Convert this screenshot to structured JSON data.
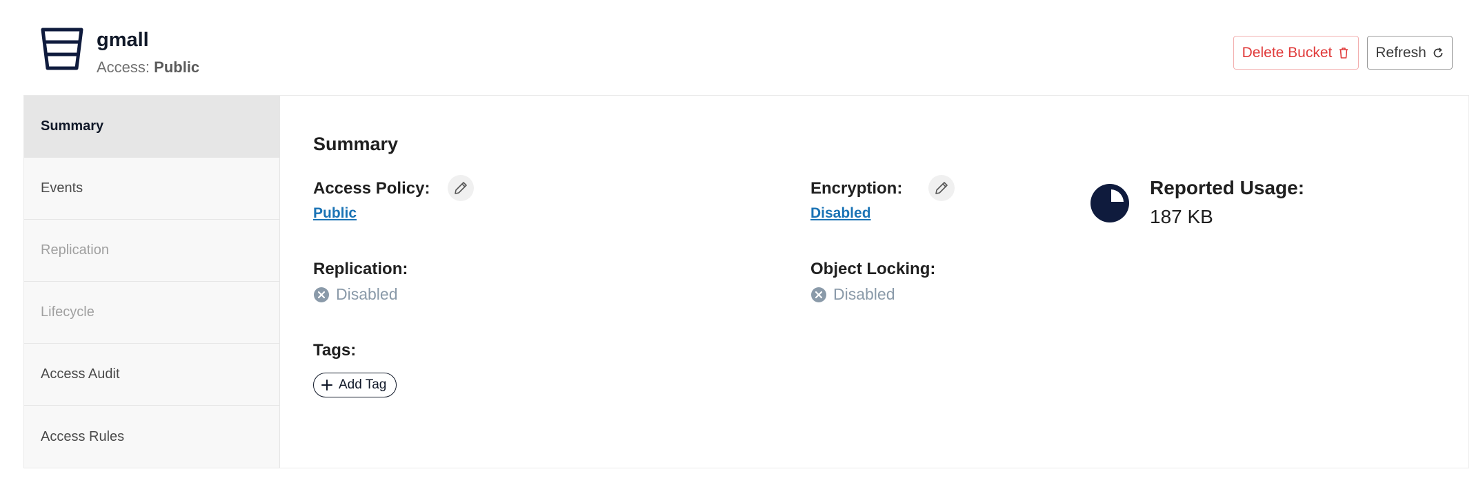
{
  "header": {
    "bucket_name": "gmall",
    "access_label": "Access:",
    "access_value": "Public",
    "delete_label": "Delete Bucket",
    "refresh_label": "Refresh"
  },
  "sidebar": {
    "items": [
      {
        "label": "Summary",
        "state": "active"
      },
      {
        "label": "Events",
        "state": "enabled"
      },
      {
        "label": "Replication",
        "state": "disabled"
      },
      {
        "label": "Lifecycle",
        "state": "disabled"
      },
      {
        "label": "Access Audit",
        "state": "enabled"
      },
      {
        "label": "Access Rules",
        "state": "enabled"
      }
    ]
  },
  "summary": {
    "title": "Summary",
    "access_policy": {
      "label": "Access Policy:",
      "value": "Public"
    },
    "encryption": {
      "label": "Encryption:",
      "value": "Disabled"
    },
    "replication": {
      "label": "Replication:",
      "value": "Disabled"
    },
    "object_locking": {
      "label": "Object Locking:",
      "value": "Disabled"
    },
    "tags": {
      "label": "Tags:",
      "add_label": "Add Tag"
    },
    "usage": {
      "label": "Reported Usage:",
      "value": "187 KB"
    }
  },
  "colors": {
    "brand_navy": "#0f1b3d",
    "danger": "#e03a3a",
    "link": "#1a73b5",
    "muted_status": "#8a9aa9"
  },
  "icons": [
    "bucket-icon",
    "trash-icon",
    "refresh-icon",
    "pencil-icon",
    "x-circle-icon",
    "pie-chart-icon",
    "plus-icon"
  ]
}
